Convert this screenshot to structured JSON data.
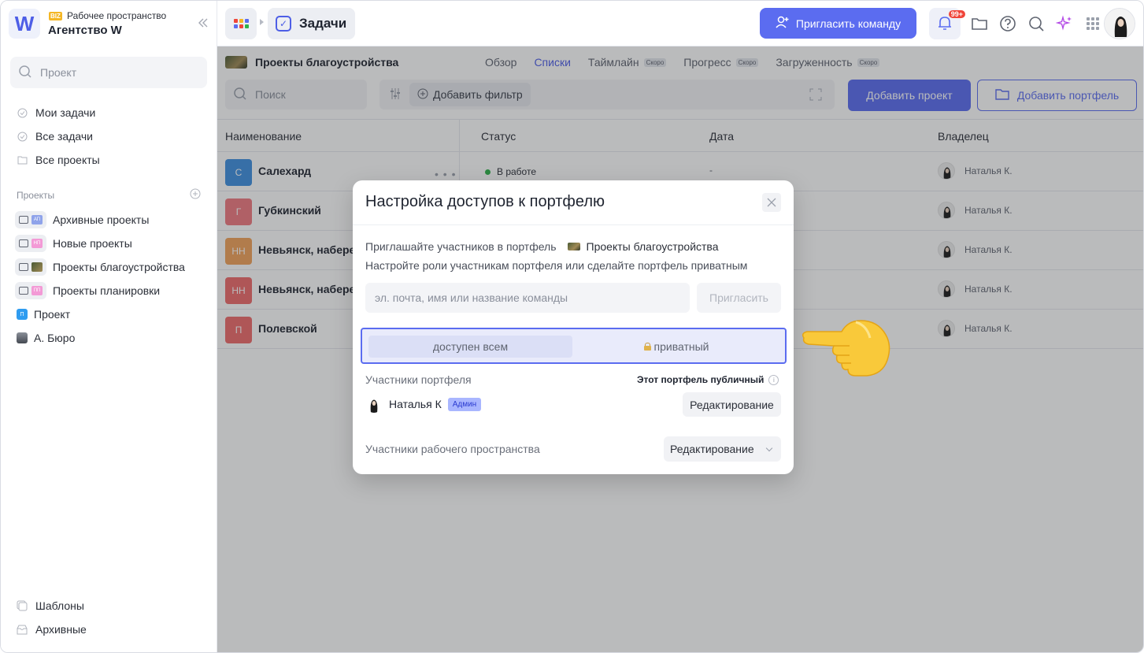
{
  "sidebar": {
    "workspace_badge": "BIZ",
    "workspace_label": "Рабочее пространство",
    "workspace_name": "Агентство W",
    "logo_letter": "W",
    "search_placeholder": "Проект",
    "nav": [
      {
        "label": "Мои задачи"
      },
      {
        "label": "Все задачи"
      },
      {
        "label": "Все проекты"
      }
    ],
    "projects_title": "Проекты",
    "projects": [
      {
        "label": "Архивные проекты",
        "badge": "АП",
        "color": "#8fa3ea"
      },
      {
        "label": "Новые проекты",
        "badge": "НП",
        "color": "#f39ad6"
      },
      {
        "label": "Проекты благоустройства",
        "badge": "",
        "color": "#6b6a3e"
      },
      {
        "label": "Проекты планировки",
        "badge": "ПП",
        "color": "#f39ad6"
      },
      {
        "label": "Проект",
        "badge": "П",
        "color": "#2f9cf0"
      },
      {
        "label": "А. Бюро",
        "badge": "",
        "color": "#59606c"
      }
    ],
    "bottom": [
      {
        "label": "Шаблоны"
      },
      {
        "label": "Архивные"
      }
    ]
  },
  "topbar": {
    "tasks_label": "Задачи",
    "invite_team": "Пригласить команду",
    "notif_badge": "99+"
  },
  "main": {
    "portfolio_title": "Проекты благоустройства",
    "tabs": [
      {
        "label": "Обзор",
        "soon": ""
      },
      {
        "label": "Списки",
        "soon": ""
      },
      {
        "label": "Таймлайн",
        "soon": "Скоро"
      },
      {
        "label": "Прогресс",
        "soon": "Скоро"
      },
      {
        "label": "Загруженность",
        "soon": "Скоро"
      }
    ],
    "search_placeholder": "Поиск",
    "add_filter": "Добавить фильтр",
    "add_project": "Добавить проект",
    "add_portfolio": "Добавить портфель",
    "columns": [
      "Наименование",
      "Статус",
      "Дата",
      "Владелец"
    ],
    "rows": [
      {
        "badge": "С",
        "name": "Салехард",
        "status": "В работе",
        "date": "-",
        "owner": "Наталья К.",
        "color": "#3f8fe0"
      },
      {
        "badge": "Г",
        "name": "Губкинский",
        "status": "",
        "date": "",
        "owner": "Наталья К.",
        "color": "#f07a80"
      },
      {
        "badge": "НН",
        "name": "Невьянск, набере",
        "status": "",
        "date": "",
        "owner": "Наталья К.",
        "color": "#f2a35a"
      },
      {
        "badge": "НН",
        "name": "Невьянск, набере",
        "status": "",
        "date": "",
        "owner": "Наталья К.",
        "color": "#ef6b6b"
      },
      {
        "badge": "П",
        "name": "Полевской",
        "status": "",
        "date": "",
        "owner": "Наталья К.",
        "color": "#ef6b6b"
      }
    ]
  },
  "modal": {
    "title": "Настройка доступов к портфелю",
    "invite_line": "Приглашайте участников в портфель",
    "portfolio_name": "Проекты благоустройства",
    "roles_line": "Настройте роли участникам портфеля или сделайте портфель приватным",
    "input_placeholder": "эл. почта, имя или название команды",
    "invite_button": "Пригласить",
    "seg_public": "доступен всем",
    "seg_private": "приватный",
    "members_label": "Участники портфеля",
    "public_label": "Этот портфель публичный",
    "member_name": "Наталья К",
    "member_badge": "Админ",
    "member_role": "Редактирование",
    "ws_members_label": "Участники рабочего пространства",
    "ws_role": "Редактирование"
  }
}
